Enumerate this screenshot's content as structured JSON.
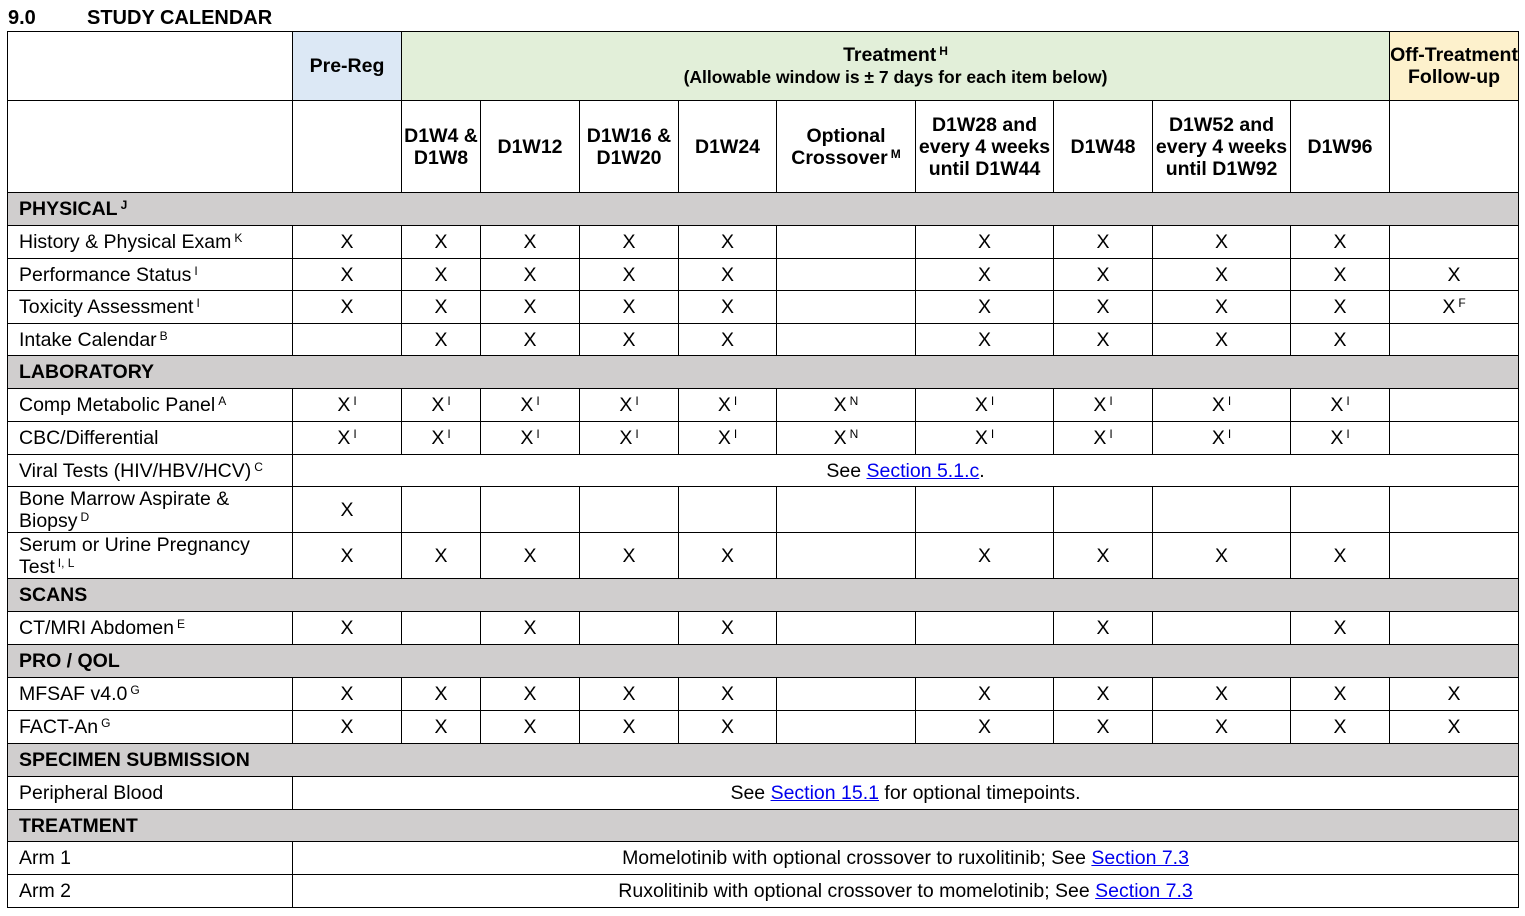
{
  "heading": {
    "number": "9.0",
    "title": "STUDY CALENDAR"
  },
  "phase_header": {
    "pre_reg": "Pre-Reg",
    "treatment": "Treatment",
    "treatment_sup": "H",
    "treatment_window": "(Allowable window is ± 7 days for each item below)",
    "off_treatment": "Off-Treatment Follow-up"
  },
  "visits": {
    "c1": "D1W4 & D1W8",
    "c2": "D1W12",
    "c3": "D1W16 & D1W20",
    "c4": "D1W24",
    "c5": "Optional Crossover",
    "c5_sup": "M",
    "c6": "D1W28 and every 4 weeks until D1W44",
    "c7": "D1W48",
    "c8": "D1W52 and every 4 weeks until D1W92",
    "c9": "D1W96"
  },
  "mark": "X",
  "sections": {
    "physical": "PHYSICAL",
    "physical_sup": "J",
    "laboratory": "LABORATORY",
    "scans": "SCANS",
    "pro_qol": "PRO / QOL",
    "specimen": "SPECIMEN SUBMISSION",
    "treatment": "TREATMENT"
  },
  "rows": {
    "history": {
      "label": "History & Physical Exam",
      "sup": "K"
    },
    "performance": {
      "label": "Performance Status",
      "sup": "I"
    },
    "toxicity": {
      "label": "Toxicity Assessment",
      "sup": "I",
      "off_sup": "F"
    },
    "intake": {
      "label": "Intake Calendar",
      "sup": "B"
    },
    "cmp": {
      "label": "Comp Metabolic Panel",
      "sup": "A",
      "cell_sup": "I",
      "crossover_sup": "N"
    },
    "cbc": {
      "label": "CBC/Differential",
      "cell_sup": "I",
      "crossover_sup": "N"
    },
    "viral": {
      "label": "Viral Tests (HIV/HBV/HCV)",
      "sup": "C",
      "note_pre": "See ",
      "note_link": "Section 5.1.c",
      "note_post": "."
    },
    "marrow": {
      "label": "Bone Marrow Aspirate & Biopsy",
      "sup": "D"
    },
    "pregnancy": {
      "label": "Serum or Urine Pregnancy Test",
      "sup": "I, L"
    },
    "ct": {
      "label": "CT/MRI Abdomen",
      "sup": "E"
    },
    "mfsaf": {
      "label": "MFSAF v4.0",
      "sup": "G"
    },
    "fact": {
      "label": "FACT-An",
      "sup": "G"
    },
    "blood": {
      "label": "Peripheral Blood",
      "note_pre": "See ",
      "note_link": "Section 15.1",
      "note_post": " for optional timepoints."
    },
    "arm1": {
      "label": "Arm 1",
      "note_pre": "Momelotinib with optional crossover to ruxolitinib; See ",
      "note_link": "Section 7.3"
    },
    "arm2": {
      "label": "Arm 2",
      "note_pre": "Ruxolitinib with optional crossover to momelotinib; See ",
      "note_link": "Section 7.3"
    }
  }
}
